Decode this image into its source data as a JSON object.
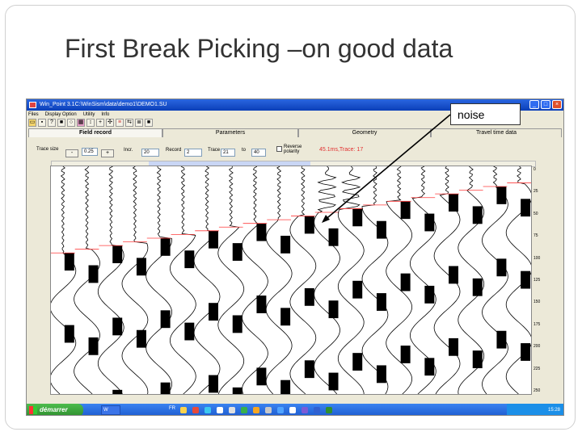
{
  "slide": {
    "title": "First Break Picking –on good data",
    "callout": "noise"
  },
  "app": {
    "window_title": "Win_Point 3.1C:\\WinSism\\data\\demo1\\DEMO1.SU",
    "menu": [
      "Files",
      "Display Option",
      "Utility",
      "Info"
    ],
    "tabs": [
      {
        "label": "Field record",
        "active": true
      },
      {
        "label": "Parameters",
        "active": false
      },
      {
        "label": "Geometry",
        "active": false
      },
      {
        "label": "Travel time data",
        "active": false
      }
    ],
    "params": {
      "trace_size_label": "Trace size",
      "minus_label": "-",
      "trace_size_value": "0.25",
      "plus_label": "+",
      "incr_label": "Incr.",
      "incr_value": "20",
      "record_label": "Record",
      "record_value": "2",
      "trace_label": "Trace",
      "trace_value": "21",
      "to_label": "to",
      "to_value": "40",
      "reverse_polarity_label": "Reverse polarity",
      "status": "45.1ms,Trace: 17"
    },
    "y_ticks": [
      "0",
      "25",
      "50",
      "75",
      "100",
      "125",
      "150",
      "175",
      "200",
      "225",
      "250"
    ]
  },
  "taskbar": {
    "start_label": "démarrer",
    "task_item": "W",
    "language": "FR",
    "clock": "15:28"
  },
  "colors": {
    "pick_line": "#ff3b3b",
    "titlebar": "#0b3fb8",
    "start": "#2f8f2f"
  }
}
